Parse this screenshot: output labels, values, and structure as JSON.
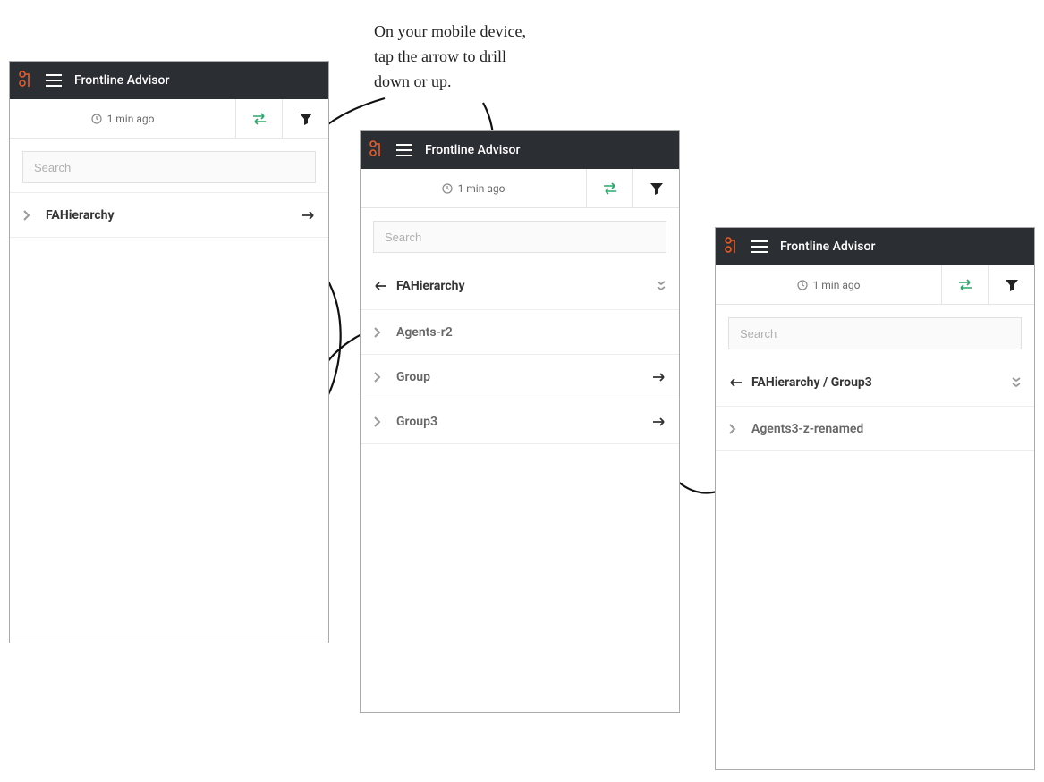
{
  "annotation": "On your mobile device,\ntap the arrow to drill\ndown or up.",
  "header": {
    "title": "Frontline Advisor"
  },
  "toolbar": {
    "timestamp": "1 min ago"
  },
  "search": {
    "placeholder": "Search"
  },
  "screen1": {
    "rows": [
      {
        "label": "FAHierarchy",
        "left": "chevron",
        "right": "arrow-right"
      }
    ]
  },
  "screen2": {
    "breadcrumb": {
      "label": "FAHierarchy",
      "left": "arrow-left",
      "right": "double-chevron"
    },
    "rows": [
      {
        "label": "Agents-r2",
        "left": "chevron",
        "right": ""
      },
      {
        "label": "Group",
        "left": "chevron",
        "right": "arrow-right"
      },
      {
        "label": "Group3",
        "left": "chevron",
        "right": "arrow-right"
      }
    ]
  },
  "screen3": {
    "breadcrumb": {
      "label": "FAHierarchy / Group3",
      "left": "arrow-left",
      "right": "double-chevron"
    },
    "rows": [
      {
        "label": "Agents3-z-renamed",
        "left": "chevron",
        "right": ""
      }
    ]
  }
}
